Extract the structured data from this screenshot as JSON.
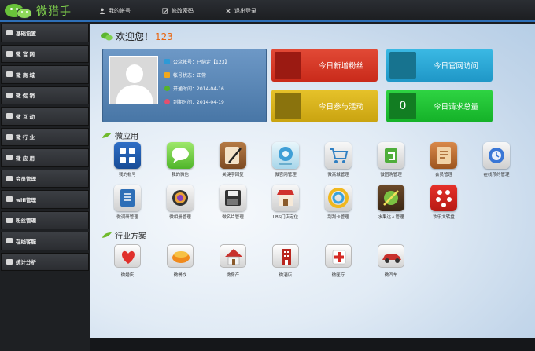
{
  "brand": {
    "name": "微猎手"
  },
  "topnav": [
    {
      "label": "我的帐号",
      "icon": "user-icon"
    },
    {
      "label": "修改密码",
      "icon": "edit-icon"
    },
    {
      "label": "退出登录",
      "icon": "logout-icon"
    }
  ],
  "sidebar": {
    "items": [
      {
        "label": "基础设置"
      },
      {
        "label": "微 官 网"
      },
      {
        "label": "微 商 城"
      },
      {
        "label": "微 促 销"
      },
      {
        "label": "微 互 动"
      },
      {
        "label": "微 行 业"
      },
      {
        "label": "微 应 用"
      },
      {
        "label": "会员管理"
      },
      {
        "label": "wifi管理"
      },
      {
        "label": "粉丝管理"
      },
      {
        "label": "在线客服"
      },
      {
        "label": "统计分析"
      }
    ]
  },
  "welcome": {
    "text": "欢迎您！",
    "username": "123"
  },
  "account": {
    "rows": [
      {
        "text": "公众帐号：已绑定【123】",
        "icon": "wechat-icon",
        "color": "#2e9ad6"
      },
      {
        "text": "帐号状态：正常",
        "icon": "status-icon",
        "color": "#f0a81e"
      },
      {
        "text": "开通时间：2014-04-16",
        "icon": "check-icon",
        "color": "#55b32b"
      },
      {
        "text": "到期时间：2014-04-19",
        "icon": "clock-icon",
        "color": "#e2506e"
      }
    ]
  },
  "stats": [
    {
      "label": "今日新增粉丝",
      "value": "",
      "color": "#dc3626",
      "sq": "#9b1a12"
    },
    {
      "label": "今日官网访问",
      "value": "",
      "color": "#2aa9d8",
      "sq": "#17738f"
    },
    {
      "label": "今日参与活动",
      "value": "",
      "color": "#d8b21b",
      "sq": "#8a730d"
    },
    {
      "label": "今日请求总量",
      "value": "0",
      "color": "#1ec533",
      "sq": "#127d22"
    }
  ],
  "apps_section": {
    "title": "微应用"
  },
  "apps": [
    {
      "label": "我的帐号",
      "icon": "account-icon"
    },
    {
      "label": "我的微信",
      "icon": "wechat-chat-icon"
    },
    {
      "label": "关键字回复",
      "icon": "keyword-reply-icon"
    },
    {
      "label": "微官网管理",
      "icon": "website-icon"
    },
    {
      "label": "微商城管理",
      "icon": "shopping-cart-icon"
    },
    {
      "label": "微团购管理",
      "icon": "group-buy-icon"
    },
    {
      "label": "会员管理",
      "icon": "member-book-icon"
    },
    {
      "label": "在线预约管理",
      "icon": "booking-icon"
    },
    {
      "label": "微调研管理",
      "icon": "survey-icon"
    },
    {
      "label": "微相册管理",
      "icon": "album-icon"
    },
    {
      "label": "微名片管理",
      "icon": "floppy-icon"
    },
    {
      "label": "LBS门店定位",
      "icon": "store-icon"
    },
    {
      "label": "刮刮卡管理",
      "icon": "scratch-card-icon"
    },
    {
      "label": "水果达人管理",
      "icon": "fruit-icon"
    },
    {
      "label": "欢乐大转盘",
      "icon": "wheel-icon"
    }
  ],
  "industry_section": {
    "title": "行业方案"
  },
  "industries": [
    {
      "label": "微婚庆",
      "icon": "wedding-icon"
    },
    {
      "label": "微餐饮",
      "icon": "restaurant-icon"
    },
    {
      "label": "微房产",
      "icon": "house-icon"
    },
    {
      "label": "微酒店",
      "icon": "hotel-icon"
    },
    {
      "label": "微医疗",
      "icon": "medical-icon"
    },
    {
      "label": "微汽车",
      "icon": "car-icon"
    }
  ]
}
